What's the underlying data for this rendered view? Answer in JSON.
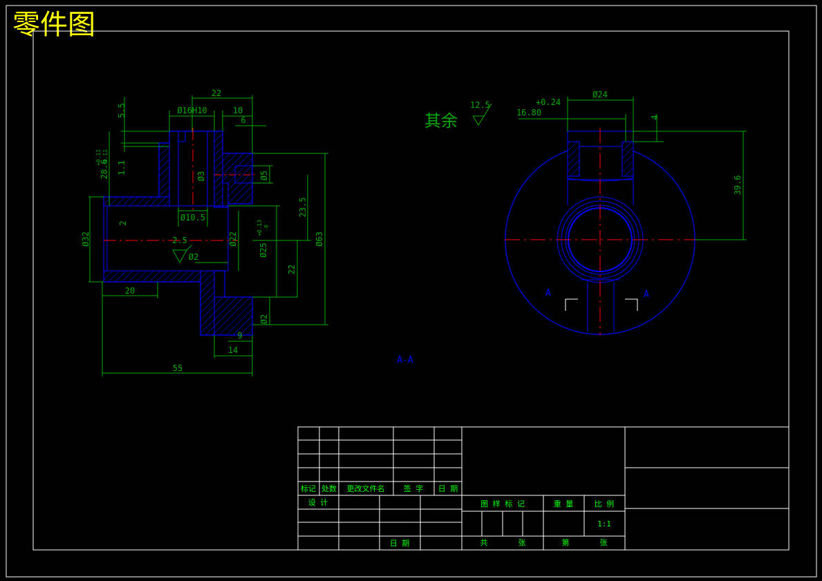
{
  "drawing": {
    "title": "零件图",
    "section_label": "A-A",
    "section_marker": "A",
    "roughness_note": {
      "prefix": "其余",
      "value": "12.5"
    },
    "colors": {
      "frame": "#ffffff",
      "outline": "#0000ff",
      "dimension": "#00aa00",
      "centerline": "#ff0000",
      "title": "#ffff00",
      "label": "#0000ff"
    }
  },
  "section_view": {
    "dimensions": [
      "22",
      "Ø16H10",
      "10",
      "6",
      "5.5",
      "28.6",
      "+0.11",
      "-0.11",
      "1.1",
      "Ø3",
      "Ø5",
      "23.5",
      "Ø63",
      "Ø10.5",
      "Ø32",
      "2",
      "2.5",
      "Ø2",
      "Ø22",
      "Ø25",
      "+0.13",
      "-0",
      "22",
      "20",
      "Ø2",
      "9",
      "14",
      "55"
    ]
  },
  "plan_view": {
    "dimensions": [
      "Ø24",
      "+0.24",
      "16.80",
      "4",
      "39.6"
    ]
  },
  "title_block": {
    "rev_headers": [
      "标记",
      "处数",
      "更改文件名",
      "签 字",
      "日 期"
    ],
    "design_label": "设 计",
    "date_label": "日 期",
    "drawing_mark_label": "图 样 标 记",
    "weight_label": "重 量",
    "scale_label": "比 例",
    "scale_value": "1:1",
    "total_label": "共",
    "sheet_unit": "张",
    "page_label": "第",
    "page_unit": "张"
  }
}
